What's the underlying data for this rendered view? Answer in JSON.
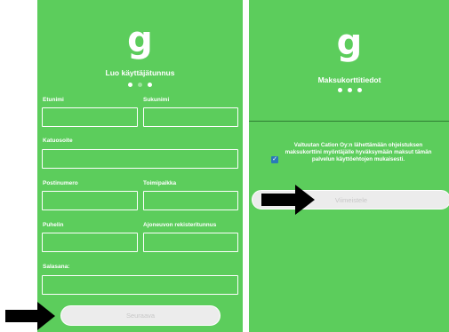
{
  "left_screen": {
    "logo": "g",
    "title": "Luo käyttäjätunnus",
    "labels": {
      "first_name": "Etunimi",
      "last_name": "Sukunimi",
      "street": "Katuosoite",
      "postal_code": "Postinumero",
      "city": "Toimipaikka",
      "phone": "Puhelin",
      "plate": "Ajoneuvon rekisteritunnus",
      "password": "Salasana:"
    },
    "next_button": "Seuraava"
  },
  "right_screen": {
    "logo": "g",
    "title": "Maksukorttitiedot",
    "consent_text": "Valtuutan Cation Oy:n lähettämään ohjeistuksen maksukorttini myöntäjälle hyväksymään maksut tämän palvelun käyttöehtojen mukaisesti.",
    "finish_button": "Viimeistele"
  },
  "colors": {
    "screen_bg": "#5ccd5c",
    "arrow": "#000000",
    "checkbox": "#2a7ab8"
  },
  "icons": {
    "arrow": "right-arrow-icon",
    "check": "checkmark-icon"
  }
}
